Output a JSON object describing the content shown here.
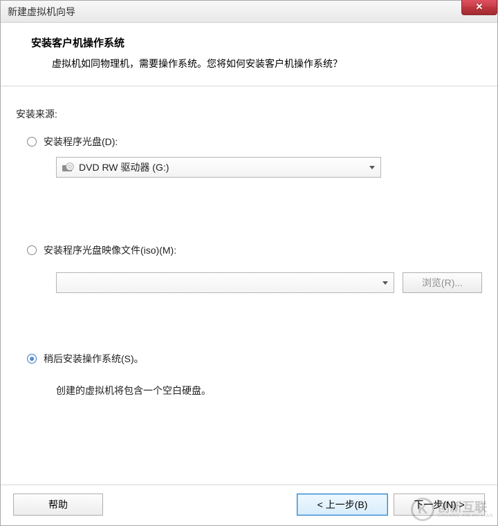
{
  "titlebar": {
    "title": "新建虚拟机向导"
  },
  "header": {
    "title": "安装客户机操作系统",
    "subtitle": "虚拟机如同物理机，需要操作系统。您将如何安装客户机操作系统？"
  },
  "source": {
    "label": "安装来源:",
    "disc": {
      "label": "安装程序光盘(D):",
      "selected_value": "DVD RW 驱动器 (G:)"
    },
    "iso": {
      "label": "安装程序光盘映像文件(iso)(M):",
      "selected_value": "",
      "browse_label": "浏览(R)..."
    },
    "later": {
      "label": "稍后安装操作系统(S)。",
      "description": "创建的虚拟机将包含一个空白硬盘。"
    }
  },
  "footer": {
    "help_label": "帮助",
    "back_label": "< 上一步(B)",
    "next_label": "下一步(N) >"
  },
  "watermark": {
    "cn": "创新互联",
    "en": "CHUANG XIN HU LIAN"
  }
}
